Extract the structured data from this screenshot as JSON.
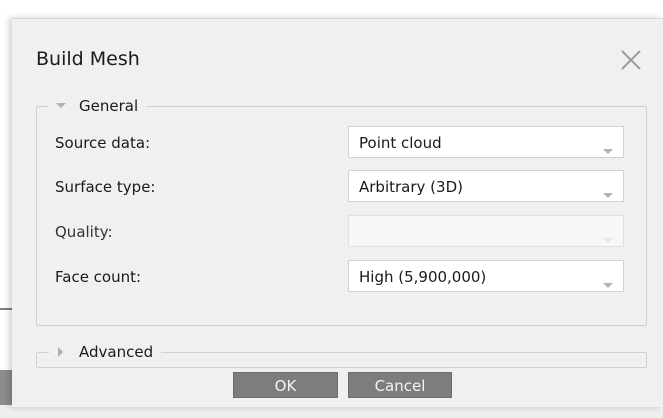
{
  "dialog": {
    "title": "Build Mesh",
    "close_icon": "close-icon",
    "general": {
      "legend": "General",
      "expanded": true,
      "fields": [
        {
          "label": "Source data:",
          "value": "Point cloud",
          "enabled": true
        },
        {
          "label": "Surface type:",
          "value": "Arbitrary (3D)",
          "enabled": true
        },
        {
          "label": "Quality:",
          "value": "",
          "enabled": false
        },
        {
          "label": "Face count:",
          "value": "High (5,900,000)",
          "enabled": true
        }
      ]
    },
    "advanced": {
      "legend": "Advanced",
      "expanded": false
    },
    "buttons": {
      "ok": "OK",
      "cancel": "Cancel"
    },
    "colors": {
      "dialog_bg": "#f0f0f0",
      "button_bg": "#7d7d7d",
      "button_text": "#f4f4f4"
    }
  }
}
